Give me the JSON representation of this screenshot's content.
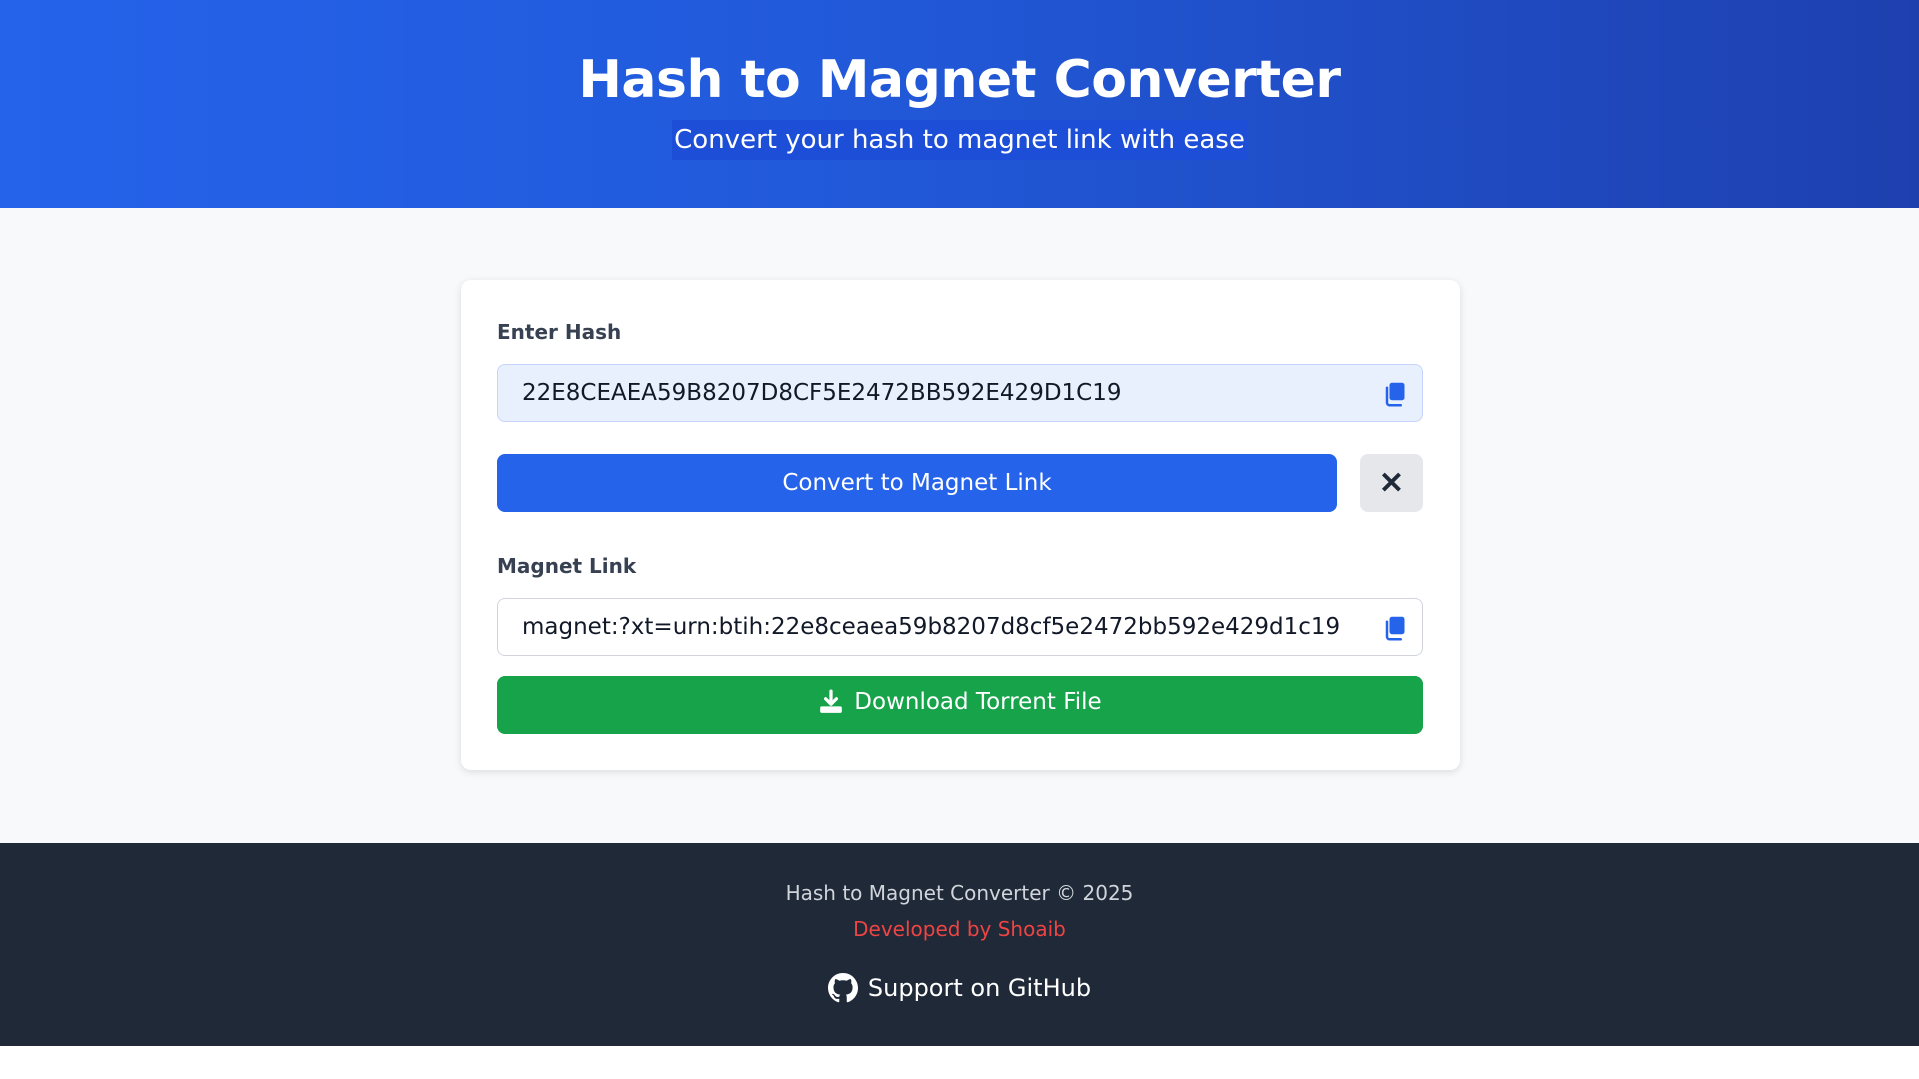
{
  "header": {
    "title": "Hash to Magnet Converter",
    "subtitle": "Convert your hash to magnet link with ease"
  },
  "form": {
    "hash_label": "Enter Hash",
    "hash_value": "22E8CEAEA59B8207D8CF5E2472BB592E429D1C19",
    "convert_label": "Convert to Magnet Link",
    "clear_icon": "close-icon",
    "magnet_label": "Magnet Link",
    "magnet_value": "magnet:?xt=urn:btih:22e8ceaea59b8207d8cf5e2472bb592e429d1c19",
    "download_label": "Download Torrent File"
  },
  "footer": {
    "copyright": "Hash to Magnet Converter © 2025",
    "developer": "Developed by Shoaib",
    "github_label": "Support on GitHub"
  },
  "colors": {
    "header_gradient_start": "#2563eb",
    "header_gradient_end": "#1e40af",
    "primary_button": "#2563eb",
    "download_button": "#16a34a",
    "footer_bg": "#1f2937",
    "developer_link": "#ef4444"
  }
}
